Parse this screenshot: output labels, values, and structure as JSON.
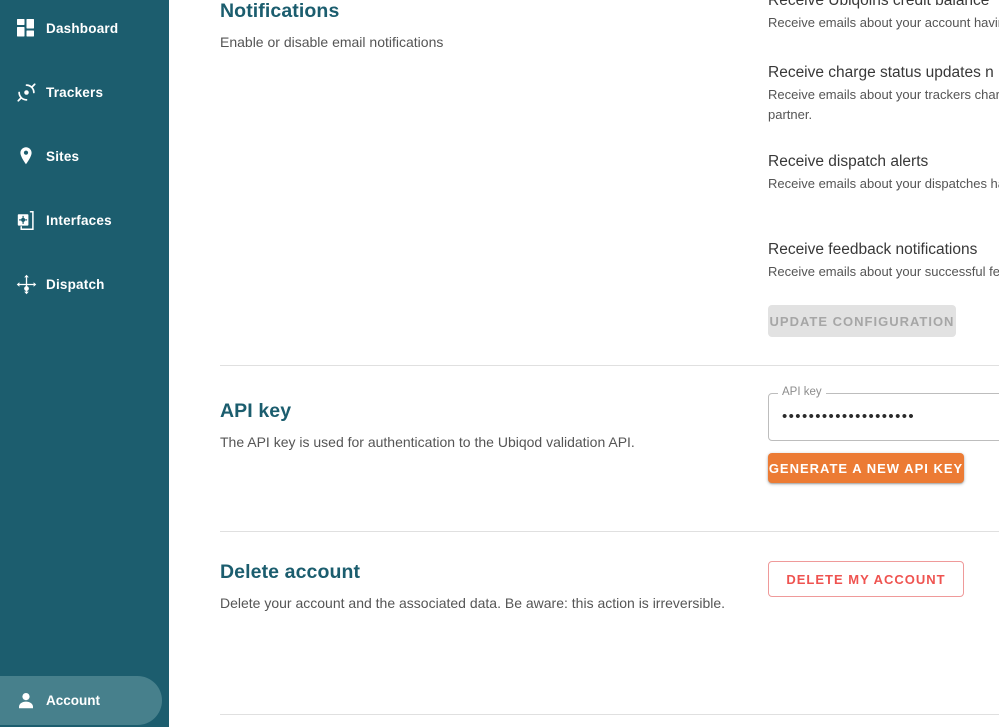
{
  "sidebar": {
    "background_color": "#1c5d6e",
    "active_color": "#47808c",
    "items": [
      {
        "label": "Dashboard",
        "icon": "dashboard-icon"
      },
      {
        "label": "Trackers",
        "icon": "tracker-icon"
      },
      {
        "label": "Sites",
        "icon": "map-pin-icon"
      },
      {
        "label": "Interfaces",
        "icon": "interface-device-icon"
      },
      {
        "label": "Dispatch",
        "icon": "move-arrows-icon"
      }
    ],
    "account": {
      "label": "Account",
      "icon": "person-icon",
      "active": true
    }
  },
  "sections": {
    "notifications": {
      "title": "Notifications",
      "description": "Enable or disable email notifications",
      "items": [
        {
          "title": "Receive Ubiqoins credit balance",
          "description": "Receive emails about your account havin"
        },
        {
          "title": "Receive charge status updates n",
          "description": "Receive emails about your trackers charg having a partner."
        },
        {
          "title": "Receive dispatch alerts",
          "description": "Receive emails about your dispatches ha deleted."
        },
        {
          "title": "Receive feedback notifications",
          "description": "Receive emails about your successful fe"
        }
      ],
      "update_button": {
        "label": "UPDATE CONFIGURATION",
        "disabled": true,
        "color": "#a6a6a6",
        "background": "#e2e2e2"
      }
    },
    "api_key": {
      "title": "API key",
      "description": "The API key is used for authentication to the Ubiqod validation API.",
      "field": {
        "label": "API key",
        "value": "••••••••••••••••••••",
        "placeholder": ""
      },
      "generate_button": {
        "label": "GENERATE A NEW API KEY",
        "background": "#ec7b34",
        "color": "#ffffff"
      }
    },
    "delete_account": {
      "title": "Delete account",
      "description": "Delete your account and the associated data. Be aware: this action is irreversible.",
      "delete_button": {
        "label": "DELETE MY ACCOUNT",
        "color": "#ef5350",
        "border_color": "#ef9a9a"
      }
    }
  },
  "theme": {
    "heading_color": "#1b5d6e",
    "body_text_color": "#555555",
    "divider_color": "#e0e0e0"
  }
}
